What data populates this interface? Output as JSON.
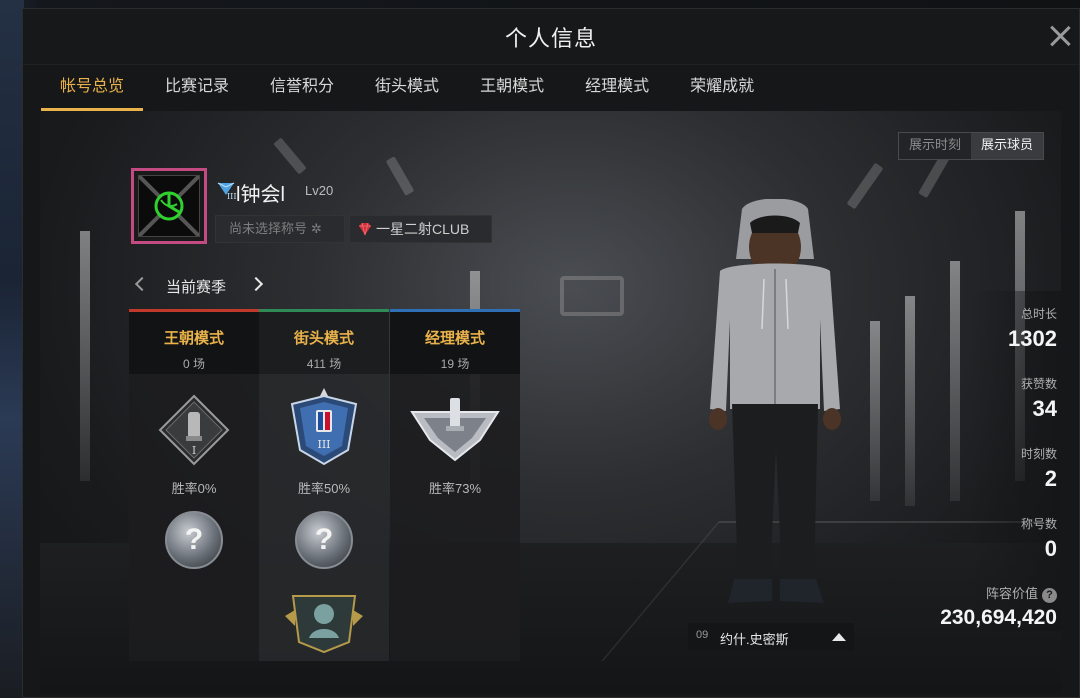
{
  "modal": {
    "title": "个人信息"
  },
  "tabs": [
    {
      "label": "帐号总览",
      "active": true
    },
    {
      "label": "比赛记录",
      "active": false
    },
    {
      "label": "信誉积分",
      "active": false
    },
    {
      "label": "街头模式",
      "active": false
    },
    {
      "label": "王朝模式",
      "active": false
    },
    {
      "label": "经理模式",
      "active": false
    },
    {
      "label": "荣耀成就",
      "active": false
    }
  ],
  "view_toggle": {
    "moments": "展示时刻",
    "players": "展示球员",
    "selected": "展示球员"
  },
  "profile": {
    "name": "l钟会l",
    "rank_tier": "III",
    "level": "Lv20",
    "title_placeholder": "尚未选择称号",
    "club": "一星二射CLUB",
    "avatar_border_color": "#c44a84"
  },
  "season": {
    "label": "当前赛季"
  },
  "modes": [
    {
      "name": "王朝模式",
      "count": "0 场",
      "winrate": "胜率0%",
      "color": "#c0392b",
      "badge_numeral": "I"
    },
    {
      "name": "街头模式",
      "count": "411 场",
      "winrate": "胜率50%",
      "color": "#2e8b57",
      "badge_numeral": "III"
    },
    {
      "name": "经理模式",
      "count": "19 场",
      "winrate": "胜率73%",
      "color": "#2f6fb5",
      "badge_numeral": ""
    }
  ],
  "unknown_badge_glyph": "?",
  "player": {
    "number": "09",
    "name": "约什.史密斯"
  },
  "stats": [
    {
      "label": "总时长",
      "value": "1302"
    },
    {
      "label": "获赞数",
      "value": "34"
    },
    {
      "label": "时刻数",
      "value": "2"
    },
    {
      "label": "称号数",
      "value": "0"
    }
  ],
  "lineup": {
    "label": "阵容价值",
    "value": "230,694,420"
  },
  "colors": {
    "accent": "#e9b24a",
    "background": "#161718"
  }
}
